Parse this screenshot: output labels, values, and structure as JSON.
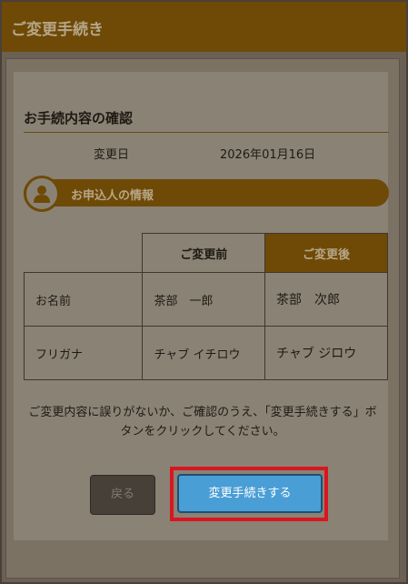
{
  "header": {
    "title": "ご変更手続き"
  },
  "confirm": {
    "title": "お手続内容の確認",
    "date_label": "変更日",
    "date_value": "2026年01月16日"
  },
  "applicant": {
    "heading": "お申込人の情報",
    "icon": "person-icon"
  },
  "table": {
    "col_before": "ご変更前",
    "col_after": "ご変更後",
    "rows": [
      {
        "label": "お名前",
        "before": "茶部　一郎",
        "after": "茶部　次郎"
      },
      {
        "label": "フリガナ",
        "before": "チャブ イチロウ",
        "after": "チャブ ジロウ"
      }
    ]
  },
  "notice": "ご変更内容に誤りがないか、ご確認のうえ、「変更手続きする」ボタンをクリックしてください。",
  "buttons": {
    "back": "戻る",
    "submit": "変更手続きする"
  },
  "colors": {
    "brand": "#6e4a06",
    "submit": "#4a9ed6",
    "highlight": "#d91620"
  }
}
